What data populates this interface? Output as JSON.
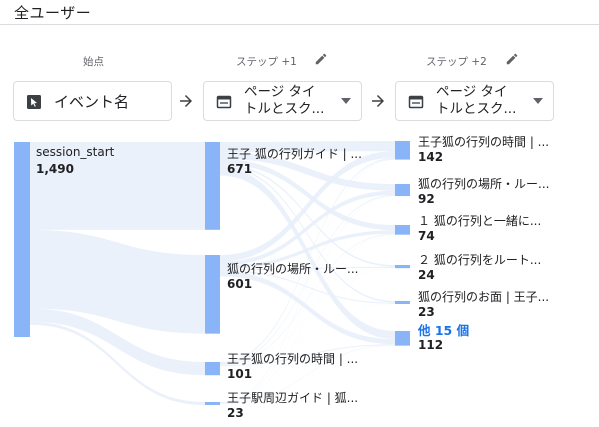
{
  "segment": {
    "title": "全ユーザー"
  },
  "columns": [
    {
      "label": "始点",
      "selector": "イベント名",
      "icon": "event-cursor-icon"
    },
    {
      "label": "ステップ +1",
      "selector_line1": "ページ タイ",
      "selector_line2": "トルとスク...",
      "icon": "page-title-icon"
    },
    {
      "label": "ステップ +2",
      "selector_line1": "ページ タイ",
      "selector_line2": "トルとスク...",
      "icon": "page-title-icon"
    }
  ],
  "colors": {
    "node": "#8ab4f8",
    "flow": "#e8eef9",
    "link": "#1a73e8"
  },
  "chart_data": {
    "type": "sankey",
    "steps": [
      {
        "name": "始点",
        "nodes": [
          {
            "label": "session_start",
            "value": 1490
          }
        ]
      },
      {
        "name": "ステップ +1",
        "nodes": [
          {
            "label": "王子 狐の行列ガイド | ...",
            "value": 671
          },
          {
            "label": "狐の行列の場所・ルー...",
            "value": 601
          },
          {
            "label": "王子狐の行列の時間 | ...",
            "value": 101
          },
          {
            "label": "王子駅周辺ガイド | 狐...",
            "value": 23
          }
        ]
      },
      {
        "name": "ステップ +2",
        "nodes": [
          {
            "label": "王子狐の行列の時間 | ...",
            "value": 142
          },
          {
            "label": "狐の行列の場所・ルー...",
            "value": 92
          },
          {
            "label": "１ 狐の行列と一緒に...",
            "value": 74
          },
          {
            "label": "２ 狐の行列をルート...",
            "value": 24
          },
          {
            "label": "狐の行列のお面 | 王子...",
            "value": 23
          },
          {
            "label": "他 15 個",
            "value": 112,
            "is_more": true
          }
        ]
      }
    ]
  },
  "display": {
    "n0": {
      "label": "session_start",
      "value": "1,490"
    },
    "n1a": {
      "label": "王子 狐の行列ガイド | ...",
      "value": "671"
    },
    "n1b": {
      "label": "狐の行列の場所・ルー...",
      "value": "601"
    },
    "n1c": {
      "label": "王子狐の行列の時間 | ...",
      "value": "101"
    },
    "n1d": {
      "label": "王子駅周辺ガイド | 狐...",
      "value": "23"
    },
    "n2a": {
      "label": "王子狐の行列の時間 | ...",
      "value": "142"
    },
    "n2b": {
      "label": "狐の行列の場所・ルー...",
      "value": "92"
    },
    "n2c": {
      "label": "１ 狐の行列と一緒に...",
      "value": "74"
    },
    "n2d": {
      "label": "２ 狐の行列をルート...",
      "value": "24"
    },
    "n2e": {
      "label": "狐の行列のお面 | 王子...",
      "value": "23"
    },
    "n2f": {
      "label": "他 15 個",
      "value": "112"
    }
  }
}
